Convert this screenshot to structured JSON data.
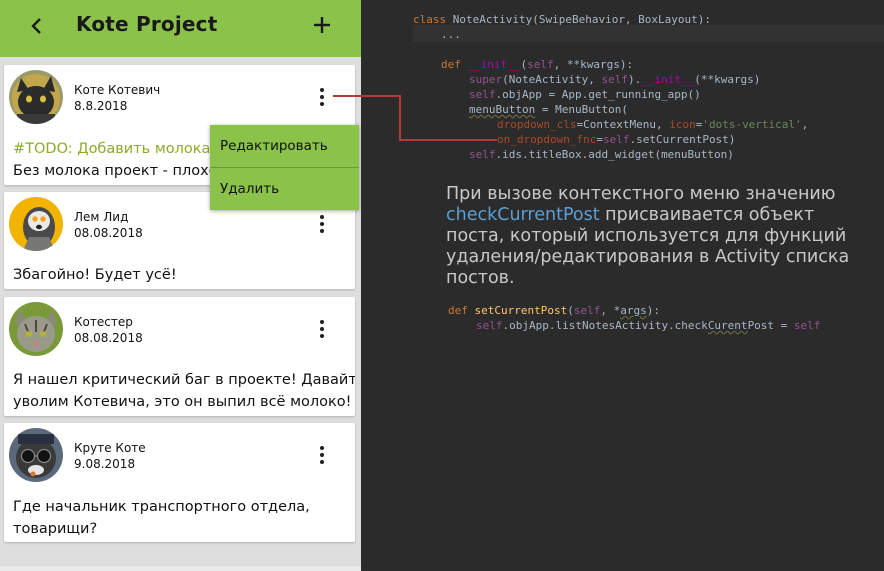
{
  "app": {
    "title": "Kote Project",
    "back_icon": "arrow-back-icon",
    "add_icon": "plus-icon",
    "accent_color": "#8bc34a"
  },
  "posts": [
    {
      "author": "Коте Котевич",
      "date": "8.8.2018",
      "todo": "#TODO: Добавить молока.",
      "text": "Без молока проект - плохой",
      "avatar": "black-cat-avatar"
    },
    {
      "author": "Лем Лид",
      "date": "08.08.2018",
      "text": "Збагойно! Будет усё!",
      "avatar": "lemur-avatar"
    },
    {
      "author": "Котестер",
      "date": "08.08.2018",
      "text": [
        "Я нашел критический баг в проекте! Давайте",
        "уволим Котевича, это он выпил всё молоко!"
      ],
      "avatar": "tabby-cat-avatar"
    },
    {
      "author": "Круте Коте",
      "date": "9.08.2018",
      "text": [
        "Где начальник транспортного отдела,",
        "товарищи?"
      ],
      "avatar": "cool-cat-avatar"
    }
  ],
  "context_menu": {
    "items": [
      "Редактировать",
      "Удалить"
    ]
  },
  "code_block_1": {
    "line1": "class NoteActivity(SwipeBehavior, BoxLayout):",
    "line2": "...",
    "def_kw": "def",
    "init_name": "__init__",
    "init_args": "(self, **kwargs):",
    "super_line": "super(NoteActivity, self).__init__(**kwargs)",
    "objapp_line": "self.objApp = App.get_running_app()",
    "menubutton_line": "menuButton = MenuButton(",
    "dropdown_cls_line": "dropdown_cls=ContextMenu, icon='dots-vertical',",
    "on_dropdown_line": "on_dropdown_fnc=self.setCurrentPost)",
    "add_widget_line": "self.ids.titleBox.add_widget(menuButton)"
  },
  "explanation": {
    "before": "При вызове контекстного меню  значению",
    "keyword": "checkCurrentPost",
    "after": " присваивается объект поста, который используется для функций удаления/редактирования в Activity списка постов."
  },
  "code_block_2": {
    "def_kw": "def",
    "fn_name": "setCurrentPost",
    "args": "(self, *args):",
    "body": "self.objApp.listNotesActivity.checkCurentPost = self"
  }
}
